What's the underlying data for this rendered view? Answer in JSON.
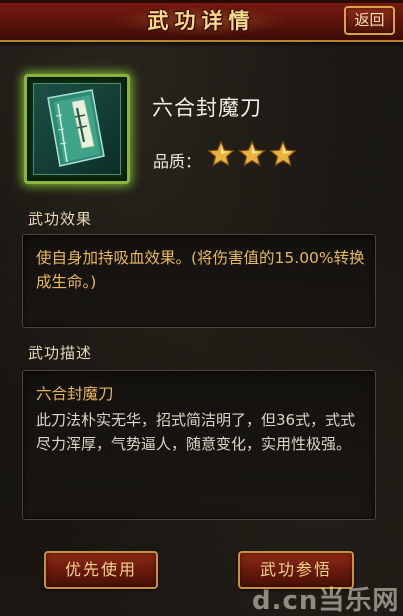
{
  "header": {
    "title": "武功详情",
    "back_label": "返回"
  },
  "skill": {
    "name": "六合封魔刀",
    "quality_label": "品质：",
    "stars": 3,
    "book_icon": "green-manual-book-icon"
  },
  "effect": {
    "label": "武功效果",
    "text": "使自身加持吸血效果。(将伤害值的15.00%转换成生命。)"
  },
  "description": {
    "label": "武功描述",
    "title": "六合封魔刀",
    "text": "此刀法朴实无华，招式简洁明了，但36式，式式尽力浑厚，气势逼人，随意变化，实用性极强。"
  },
  "buttons": {
    "priority_use": "优先使用",
    "skill_insight": "武功参悟"
  },
  "watermark": "d.cn当乐网",
  "colors": {
    "title_gold": "#f6d88c",
    "effect_orange": "#e9b85a",
    "glow_green": "#8ab43a",
    "button_red": "#8e2a16"
  }
}
